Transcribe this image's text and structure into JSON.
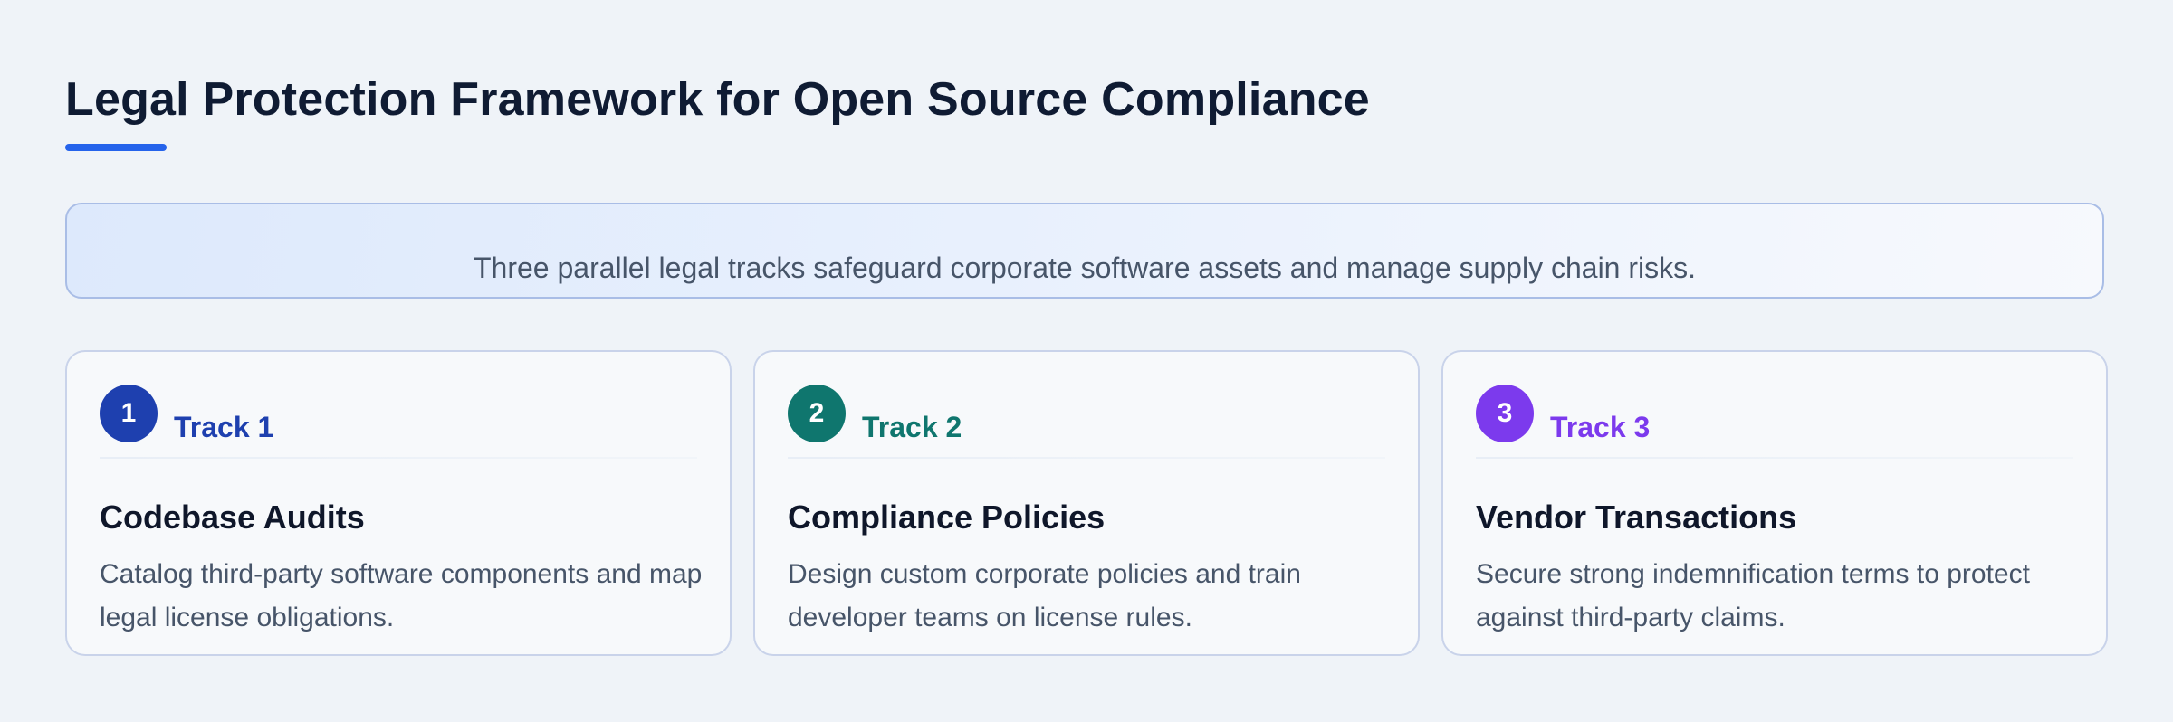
{
  "header": {
    "title": "Legal Protection Framework for Open Source Compliance"
  },
  "banner": {
    "text": "Three parallel legal tracks safeguard corporate software assets and manage supply chain risks."
  },
  "tracks": [
    {
      "number": "1",
      "label": "Track 1",
      "title": "Codebase Audits",
      "description": "Catalog third-party software components and map legal license obligations.",
      "color": "#1e40af"
    },
    {
      "number": "2",
      "label": "Track 2",
      "title": "Compliance Policies",
      "description": "Design custom corporate policies and train developer teams on license rules.",
      "color": "#0f766e"
    },
    {
      "number": "3",
      "label": "Track 3",
      "title": "Vendor Transactions",
      "description": "Secure strong indemnification terms to protect against third-party claims.",
      "color": "#7c3aed"
    }
  ],
  "colors": {
    "accent": "#2563eb",
    "background": "#eff3f8"
  }
}
